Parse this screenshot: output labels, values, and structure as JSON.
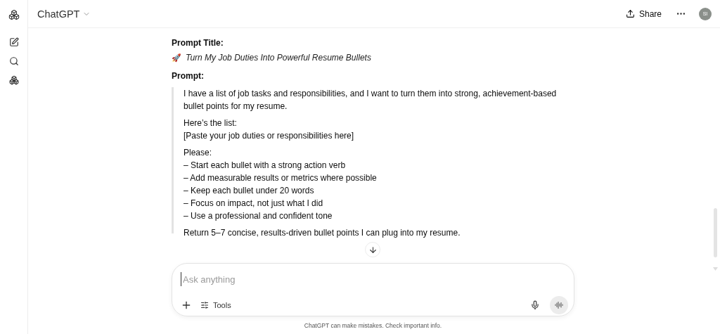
{
  "header": {
    "title": "ChatGPT",
    "share": "Share",
    "avatar": "SI"
  },
  "message": {
    "title_label": "Prompt Title:",
    "title_emoji": "🚀",
    "title": "Turn My Job Duties Into Powerful Resume Bullets",
    "prompt_label": "Prompt:",
    "paragraphs": [
      [
        "I have a list of job tasks and responsibilities, and I want to turn them into strong, achievement-based",
        "bullet points for my resume."
      ],
      [
        "Here’s the list:",
        "[Paste your job duties or responsibilities here]"
      ],
      [
        "Please:",
        "– Start each bullet with a strong action verb",
        "– Add measurable results or metrics where possible",
        "– Keep each bullet under 20 words",
        "– Focus on impact, not just what I did",
        "– Use a professional and confident tone"
      ],
      [
        "Return 5–7 concise, results-driven bullet points I can plug into my resume."
      ]
    ]
  },
  "composer": {
    "placeholder": "Ask anything",
    "tools": "Tools"
  },
  "footer": "ChatGPT can make mistakes. Check important info."
}
